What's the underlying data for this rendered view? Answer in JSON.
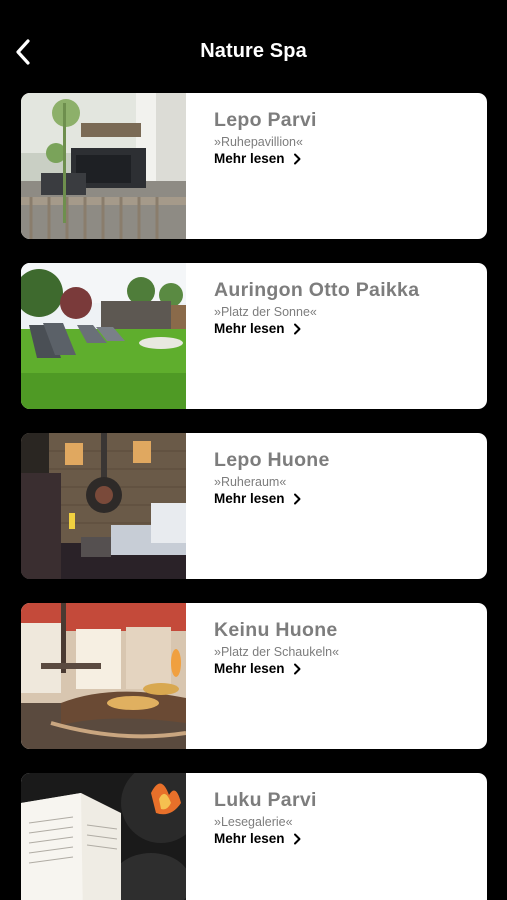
{
  "header": {
    "title": "Nature Spa",
    "back_icon": "chevron-left-icon"
  },
  "colors": {
    "background": "#000000",
    "card": "#ffffff",
    "title_gray": "#7d7d7d",
    "link": "#000000"
  },
  "items": [
    {
      "title": "Lepo Parvi",
      "subtitle": "»Ruhepavillion«",
      "link_label": "Mehr lesen",
      "image": "pavilion-lounge-photo"
    },
    {
      "title": "Auringon Otto Paikka",
      "subtitle": "»Platz der Sonne«",
      "link_label": "Mehr lesen",
      "image": "sun-lawn-photo"
    },
    {
      "title": "Lepo Huone",
      "subtitle": "»Ruheraum«",
      "link_label": "Mehr lesen",
      "image": "rest-room-fireplace-photo"
    },
    {
      "title": "Keinu Huone",
      "subtitle": "»Platz der Schaukeln«",
      "link_label": "Mehr lesen",
      "image": "swing-room-photo"
    },
    {
      "title": "Luku Parvi",
      "subtitle": "»Lesegalerie«",
      "link_label": "Mehr lesen",
      "image": "reading-gallery-photo"
    }
  ]
}
